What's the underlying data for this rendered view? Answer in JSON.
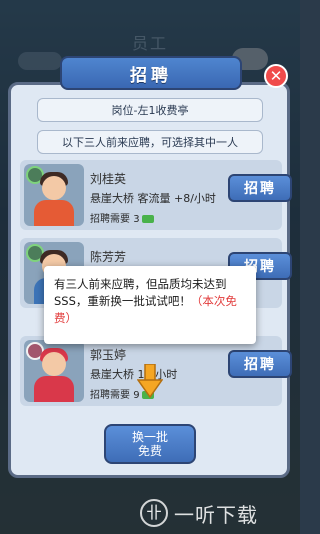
{
  "background": {
    "title": "员工"
  },
  "dialog": {
    "title": "招聘",
    "position_label": "岗位-左1收费亭",
    "hint": "以下三人前来应聘，可选择其中一人",
    "candidates": [
      {
        "name": "刘桂英",
        "stat_label": "悬崖大桥 客流量",
        "stat_value": "+8/小时",
        "cost_label": "招聘需要",
        "cost": "3",
        "hire_label": "招聘"
      },
      {
        "name": "陈芳芳",
        "stat_label": "",
        "stat_value": "",
        "cost_label": "",
        "cost": "",
        "hire_label": "招聘"
      },
      {
        "name": "郭玉婷",
        "stat_label": "悬崖大桥",
        "stat_value": "16/小时",
        "cost_label": "招聘需要",
        "cost": "9",
        "hire_label": "招聘"
      }
    ],
    "refresh_line1": "换一批",
    "refresh_line2": "免费"
  },
  "popup": {
    "message": "有三人前来应聘，但品质均未达到SSS，重新换一批试试吧！",
    "free_note": "（本次免费）"
  },
  "watermark": {
    "text": "一听下载"
  },
  "colors": {
    "accent_blue": "#3e6db7",
    "close_red": "#f04b4b",
    "free_red": "#e23c3c"
  }
}
